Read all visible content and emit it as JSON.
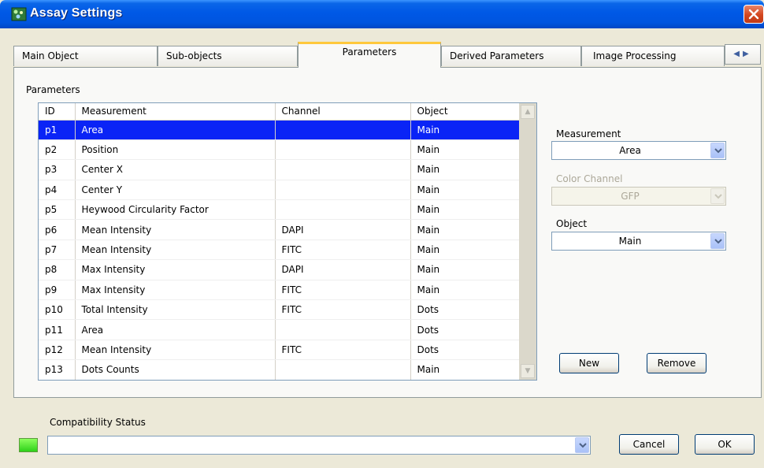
{
  "window": {
    "title": "Assay Settings",
    "close_icon": "close-icon"
  },
  "tabs": [
    {
      "label": "Main Object"
    },
    {
      "label": "Sub-objects"
    },
    {
      "label": "Parameters",
      "active": true
    },
    {
      "label": "Derived Parameters"
    },
    {
      "label": "Image Processing"
    }
  ],
  "parameters": {
    "group_label": "Parameters",
    "columns": [
      "ID",
      "Measurement",
      "Channel",
      "Object"
    ],
    "rows": [
      {
        "id": "p1",
        "measurement": "Area",
        "channel": "",
        "object": "Main",
        "selected": true
      },
      {
        "id": "p2",
        "measurement": "Position",
        "channel": "",
        "object": "Main"
      },
      {
        "id": "p3",
        "measurement": "Center X",
        "channel": "",
        "object": "Main"
      },
      {
        "id": "p4",
        "measurement": "Center Y",
        "channel": "",
        "object": "Main"
      },
      {
        "id": "p5",
        "measurement": "Heywood Circularity Factor",
        "channel": "",
        "object": "Main"
      },
      {
        "id": "p6",
        "measurement": "Mean Intensity",
        "channel": "DAPI",
        "object": "Main"
      },
      {
        "id": "p7",
        "measurement": "Mean Intensity",
        "channel": "FITC",
        "object": "Main"
      },
      {
        "id": "p8",
        "measurement": "Max Intensity",
        "channel": "DAPI",
        "object": "Main"
      },
      {
        "id": "p9",
        "measurement": "Max Intensity",
        "channel": "FITC",
        "object": "Main"
      },
      {
        "id": "p10",
        "measurement": "Total Intensity",
        "channel": "FITC",
        "object": "Dots"
      },
      {
        "id": "p11",
        "measurement": "Area",
        "channel": "",
        "object": "Dots"
      },
      {
        "id": "p12",
        "measurement": "Mean Intensity",
        "channel": "FITC",
        "object": "Dots"
      },
      {
        "id": "p13",
        "measurement": "Dots  Counts",
        "channel": "",
        "object": "Main"
      }
    ]
  },
  "editor": {
    "measurement_label": "Measurement",
    "measurement_value": "Area",
    "color_channel_label": "Color Channel",
    "color_channel_value": "GFP",
    "object_label": "Object",
    "object_value": "Main",
    "new_button": "New",
    "remove_button": "Remove"
  },
  "footer": {
    "status_label": "Compatibility Status",
    "status_value": "",
    "cancel_button": "Cancel",
    "ok_button": "OK"
  },
  "colors": {
    "title_bar": "#0055DF",
    "selection": "#0A24F6",
    "status_ok": "#3FE020",
    "active_tab_accent": "#FFC83C"
  }
}
